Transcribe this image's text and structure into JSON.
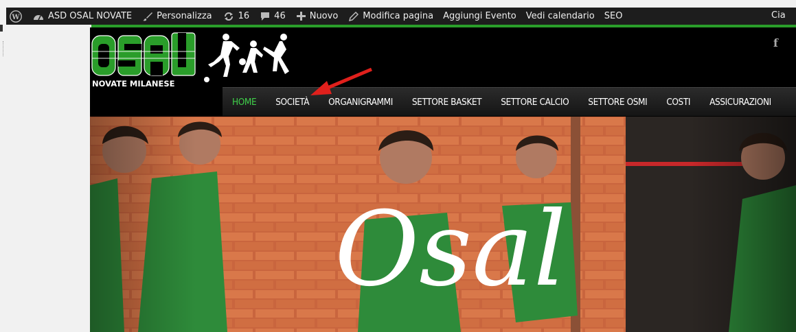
{
  "adminbar": {
    "site_name": "ASD OSAL NOVATE",
    "customize": "Personalizza",
    "updates": "16",
    "comments": "46",
    "new": "Nuovo",
    "edit_page": "Modifica pagina",
    "add_event": "Aggiungi Evento",
    "view_calendar": "Vedi calendario",
    "seo": "SEO",
    "greeting": "Cia"
  },
  "logo": {
    "sub": "NOVATE MILANESE"
  },
  "nav": {
    "items": [
      {
        "label": "HOME",
        "active": true
      },
      {
        "label": "SOCIETÀ"
      },
      {
        "label": "ORGANIGRAMMI"
      },
      {
        "label": "SETTORE BASKET"
      },
      {
        "label": "SETTORE CALCIO"
      },
      {
        "label": "SETTORE OSMI"
      },
      {
        "label": "COSTI"
      },
      {
        "label": "ASSICURAZIONI"
      }
    ]
  },
  "hero": {
    "script_title": "Osal"
  },
  "social": {
    "facebook": "f"
  },
  "colors": {
    "accent_green": "#2a9d2a",
    "arrow_red": "#e0201c"
  }
}
